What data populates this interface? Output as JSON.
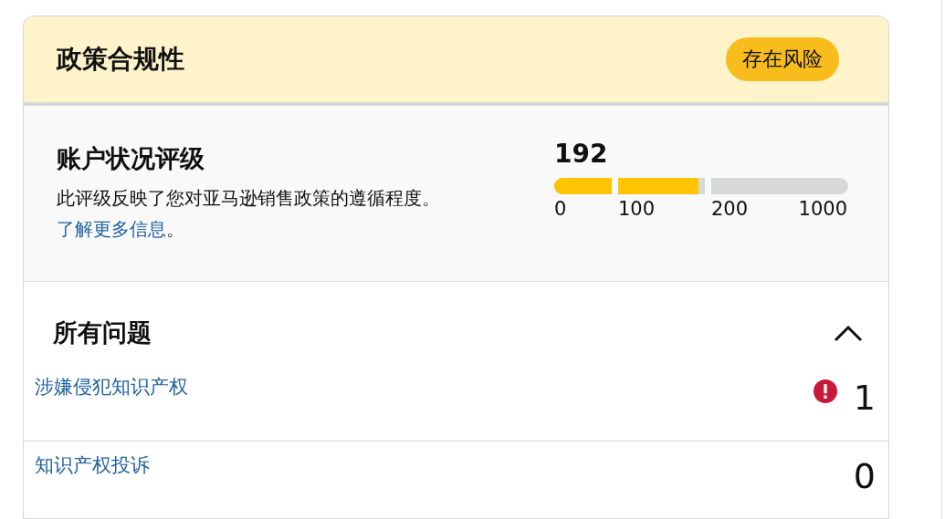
{
  "header": {
    "title": "政策合规性",
    "status_badge": "存在风险"
  },
  "rating": {
    "title": "账户状况评级",
    "description": "此评级反映了您对亚马逊销售政策的遵循程度。",
    "link": "了解更多信息",
    "period": "。",
    "score": "192",
    "level": 0.49,
    "ticks": [
      "0",
      "100",
      "200",
      "1000"
    ]
  },
  "issues": {
    "title": "所有问题",
    "expanded": true,
    "rows": [
      {
        "label": "涉嫌侵犯知识产权",
        "count": "1",
        "alert": true
      },
      {
        "label": "知识产权投诉",
        "count": "0",
        "alert": false
      }
    ]
  }
}
